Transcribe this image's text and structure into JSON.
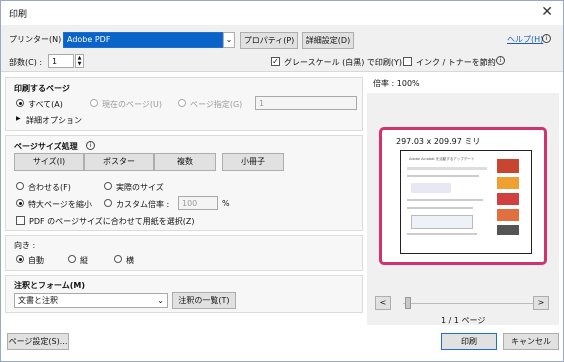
{
  "window": {
    "title": "印刷",
    "close_glyph": "✕"
  },
  "top": {
    "printer_label": "プリンター(N) :",
    "printer_value": "Adobe PDF",
    "properties_btn": "プロパティ(P)",
    "advanced_btn": "詳細設定(D)",
    "help_link": "ヘルプ(H)",
    "copies_label": "部数(C) :",
    "copies_value": "1",
    "grayscale_label": "グレースケール (白黒) で印刷(Y)",
    "save_ink_label": "インク / トナーを節約"
  },
  "pages": {
    "heading": "印刷するページ",
    "all": "すべて(A)",
    "current": "現在のページ(U)",
    "specify": "ページ指定(G)",
    "specify_value": "1",
    "more": "詳細オプション"
  },
  "sizing": {
    "heading": "ページサイズ処理",
    "tabs": [
      "サイズ(I)",
      "ポスター",
      "複数",
      "小冊子"
    ],
    "fit": "合わせる(F)",
    "actual": "実際のサイズ",
    "shrink": "特大ページを縮小",
    "custom": "カスタム倍率 :",
    "custom_value": "100",
    "percent": "%",
    "pdf_paper": "PDF のページサイズに合わせて用紙を選択(Z)"
  },
  "orientation": {
    "heading": "向き :",
    "auto": "自動",
    "portrait": "縦",
    "landscape": "横"
  },
  "comments": {
    "heading": "注釈とフォーム(M)",
    "value": "文書と注釈",
    "summary_btn": "注釈の一覧(T)"
  },
  "preview": {
    "scale": "倍率 : 100%",
    "size": "297.03 x 209.97 ミリ",
    "page_counter": "1 / 1 ページ",
    "prev": "<",
    "next": ">",
    "doc_title": "Adobe Acrobat を活動するアップデート"
  },
  "bottom": {
    "page_setup": "ページ設定(S)...",
    "print": "印刷",
    "cancel": "キャンセル"
  },
  "colors": {
    "accent": "#0a64c8",
    "highlight": "#d2336e"
  }
}
